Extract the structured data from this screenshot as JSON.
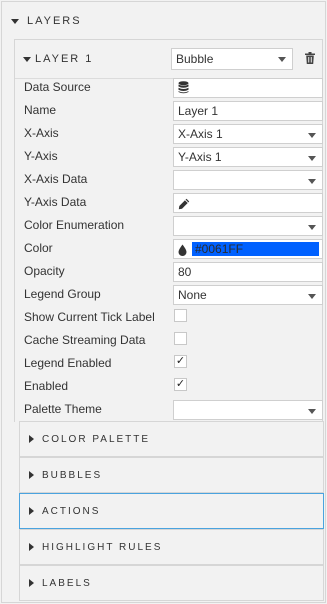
{
  "layers_header": {
    "label": "LAYERS"
  },
  "layer": {
    "title": "LAYER 1",
    "type_value": "Bubble",
    "delete_icon": "trash-icon"
  },
  "rows": {
    "data_source": {
      "label": "Data Source",
      "icon": "database-icon"
    },
    "name": {
      "label": "Name",
      "value": "Layer 1"
    },
    "x_axis": {
      "label": "X-Axis",
      "value": "X-Axis 1"
    },
    "y_axis": {
      "label": "Y-Axis",
      "value": "Y-Axis 1"
    },
    "x_axis_data": {
      "label": "X-Axis Data",
      "value": ""
    },
    "y_axis_data": {
      "label": "Y-Axis Data",
      "icon": "pencil-icon"
    },
    "color_enumeration": {
      "label": "Color Enumeration",
      "value": ""
    },
    "color": {
      "label": "Color",
      "value": "#0061FF",
      "swatch": "#0061FF",
      "icon": "droplet-icon"
    },
    "opacity": {
      "label": "Opacity",
      "value": "80"
    },
    "legend_group": {
      "label": "Legend Group",
      "value": "None"
    },
    "show_current_tick_label": {
      "label": "Show Current Tick Label",
      "checked": false
    },
    "cache_streaming_data": {
      "label": "Cache Streaming Data",
      "checked": false
    },
    "legend_enabled": {
      "label": "Legend Enabled",
      "checked": true,
      "mark": "✓"
    },
    "enabled": {
      "label": "Enabled",
      "checked": true,
      "mark": "✓"
    },
    "palette_theme": {
      "label": "Palette Theme",
      "value": ""
    }
  },
  "sections": [
    {
      "label": "COLOR PALETTE"
    },
    {
      "label": "BUBBLES"
    },
    {
      "label": "ACTIONS",
      "active": true
    },
    {
      "label": "HIGHLIGHT RULES"
    },
    {
      "label": "LABELS"
    }
  ],
  "colors": {
    "focus_border": "#4aa3df",
    "color_swatch": "#0061FF"
  }
}
